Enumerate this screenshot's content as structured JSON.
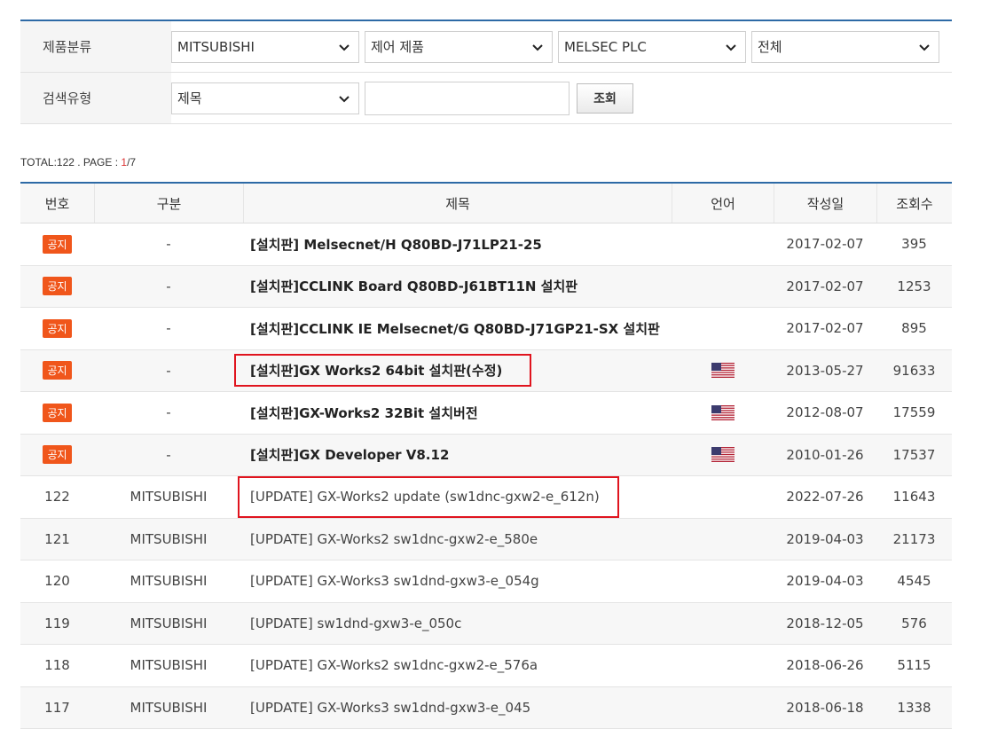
{
  "filters": {
    "category_label": "제품분류",
    "category_selects": [
      "MITSUBISHI",
      "제어 제품",
      "MELSEC PLC",
      "전체"
    ],
    "search_label": "검색유형",
    "search_type": "제목",
    "search_value": "",
    "search_button": "조회"
  },
  "summary": {
    "total_text": "TOTAL:122 . PAGE : ",
    "current_page": "1",
    "total_pages": "/7"
  },
  "table": {
    "headers": [
      "번호",
      "구분",
      "제목",
      "언어",
      "작성일",
      "조회수"
    ],
    "rows": [
      {
        "no": "공지",
        "cat": "-",
        "title": "[설치판] Melsecnet/H Q80BD-J71LP21-25",
        "lang": "",
        "date": "2017-02-07",
        "views": "395"
      },
      {
        "no": "공지",
        "cat": "-",
        "title": "[설치판]CCLINK Board Q80BD-J61BT11N 설치판",
        "lang": "",
        "date": "2017-02-07",
        "views": "1253"
      },
      {
        "no": "공지",
        "cat": "-",
        "title": "[설치판]CCLINK IE Melsecnet/G Q80BD-J71GP21-SX 설치판",
        "lang": "",
        "date": "2017-02-07",
        "views": "895"
      },
      {
        "no": "공지",
        "cat": "-",
        "title": "[설치판]GX Works2 64bit 설치판(수정)",
        "lang": "us-flag",
        "date": "2013-05-27",
        "views": "91633"
      },
      {
        "no": "공지",
        "cat": "-",
        "title": "[설치판]GX-Works2 32Bit 설치버전",
        "lang": "us-flag",
        "date": "2012-08-07",
        "views": "17559"
      },
      {
        "no": "공지",
        "cat": "-",
        "title": "[설치판]GX Developer V8.12",
        "lang": "us-flag",
        "date": "2010-01-26",
        "views": "17537"
      },
      {
        "no": "122",
        "cat": "MITSUBISHI",
        "title": "[UPDATE] GX-Works2 update (sw1dnc-gxw2-e_612n)",
        "lang": "",
        "date": "2022-07-26",
        "views": "11643"
      },
      {
        "no": "121",
        "cat": "MITSUBISHI",
        "title": "[UPDATE] GX-Works2 sw1dnc-gxw2-e_580e",
        "lang": "",
        "date": "2019-04-03",
        "views": "21173"
      },
      {
        "no": "120",
        "cat": "MITSUBISHI",
        "title": "[UPDATE] GX-Works3 sw1dnd-gxw3-e_054g",
        "lang": "",
        "date": "2019-04-03",
        "views": "4545"
      },
      {
        "no": "119",
        "cat": "MITSUBISHI",
        "title": "[UPDATE] sw1dnd-gxw3-e_050c",
        "lang": "",
        "date": "2018-12-05",
        "views": "576"
      },
      {
        "no": "118",
        "cat": "MITSUBISHI",
        "title": "[UPDATE] GX-Works2 sw1dnc-gxw2-e_576a",
        "lang": "",
        "date": "2018-06-26",
        "views": "5115"
      },
      {
        "no": "117",
        "cat": "MITSUBISHI",
        "title": "[UPDATE] GX-Works3 sw1dnd-gxw3-e_045",
        "lang": "",
        "date": "2018-06-18",
        "views": "1338"
      }
    ]
  },
  "colors": {
    "accent": "#2d6aa6",
    "badge": "#f0561b",
    "highlight": "#e0141e"
  }
}
